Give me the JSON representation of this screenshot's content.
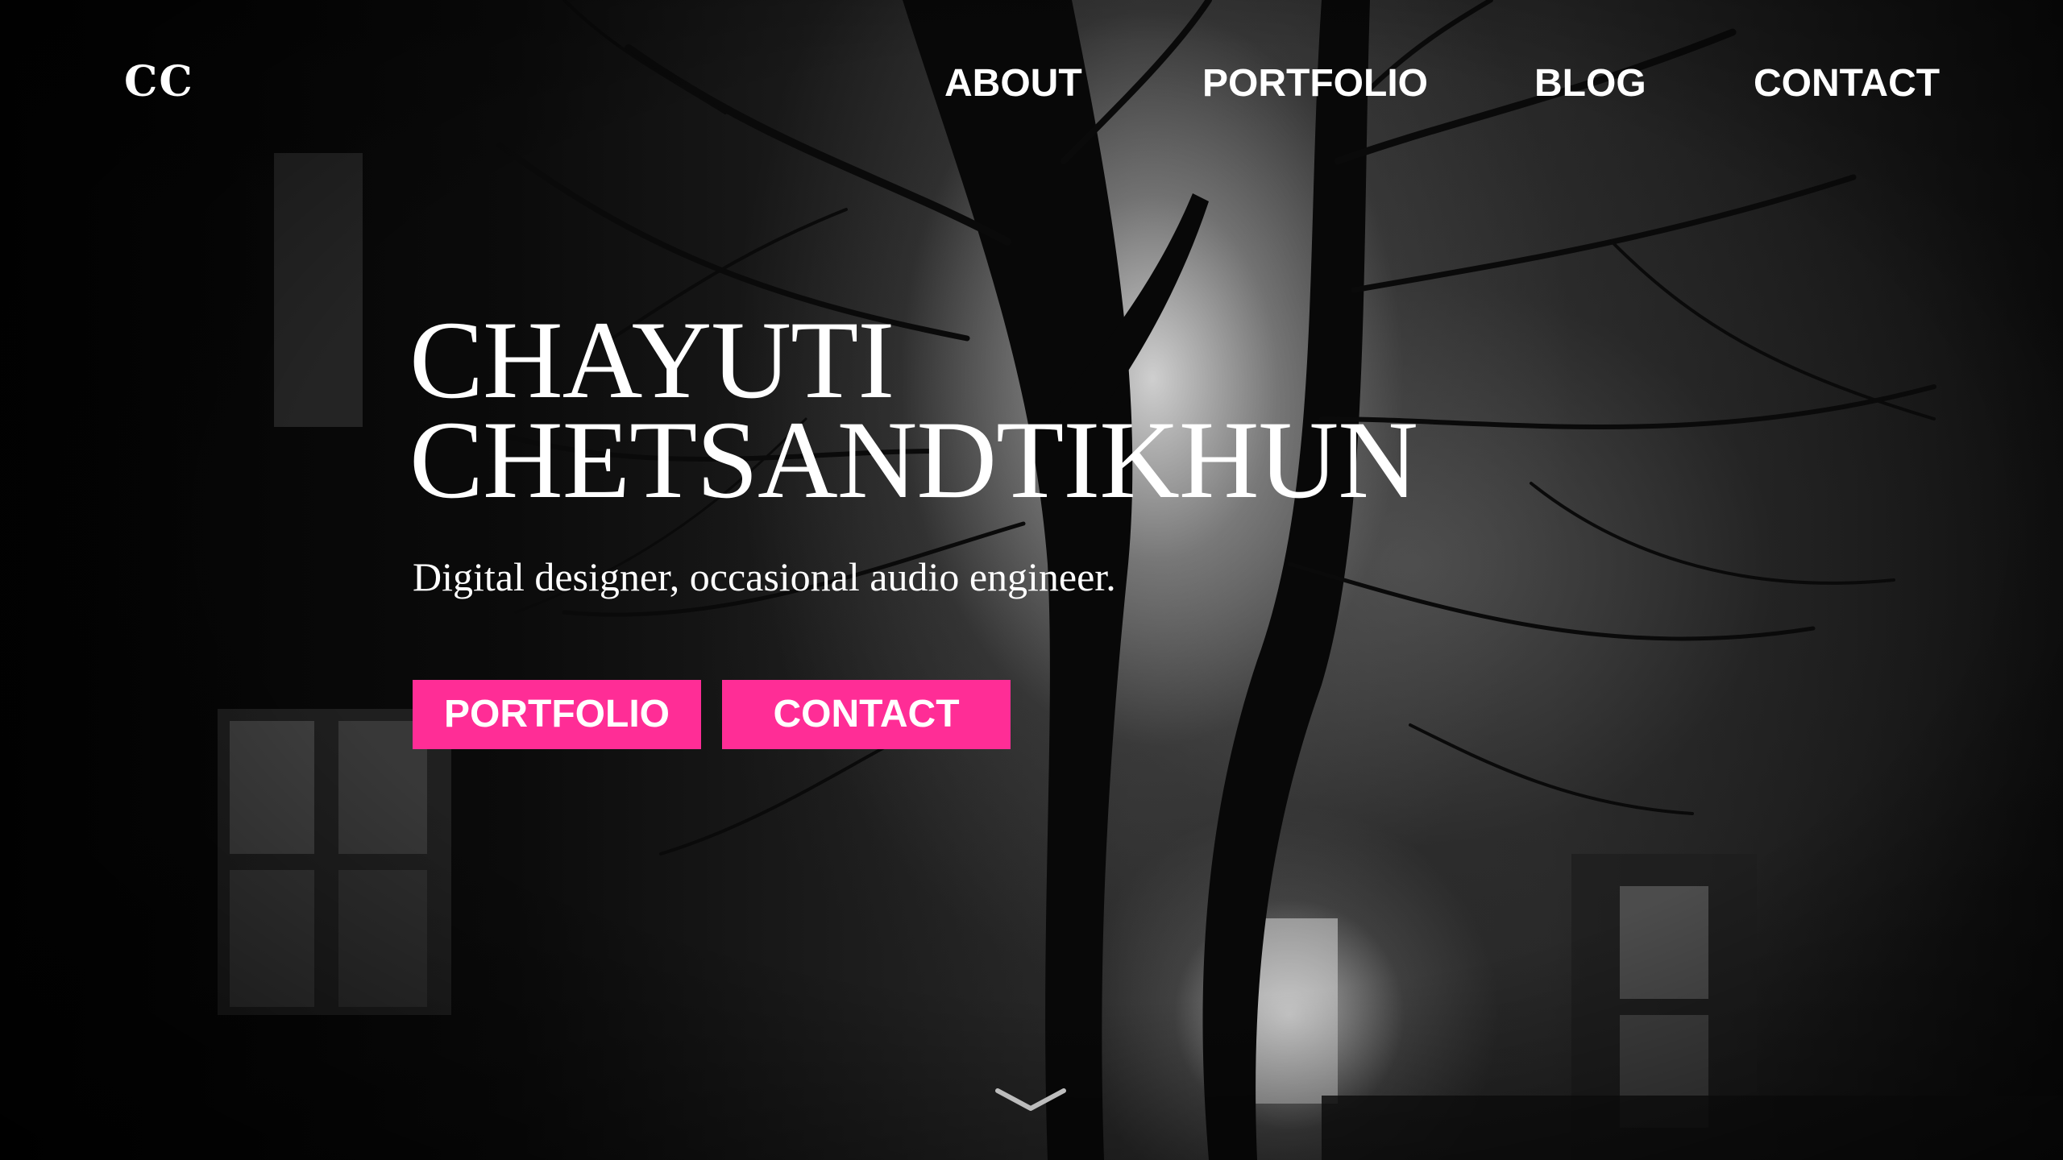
{
  "nav": {
    "logo": "CC",
    "links": [
      {
        "label": "ABOUT"
      },
      {
        "label": "PORTFOLIO"
      },
      {
        "label": "BLOG"
      },
      {
        "label": "CONTACT"
      }
    ]
  },
  "hero": {
    "title_line1": "CHAYUTI",
    "title_line2": "CHETSANDTIKHUN",
    "subtitle": "Digital designer, occasional audio engineer.",
    "buttons": [
      {
        "label": "PORTFOLIO"
      },
      {
        "label": "CONTACT"
      }
    ],
    "scroll_icon": "chevron-down-icon",
    "background": "night-trees-fog-photo"
  },
  "colors": {
    "accent": "#ff2d96",
    "text": "#ffffff",
    "background": "#050505"
  }
}
